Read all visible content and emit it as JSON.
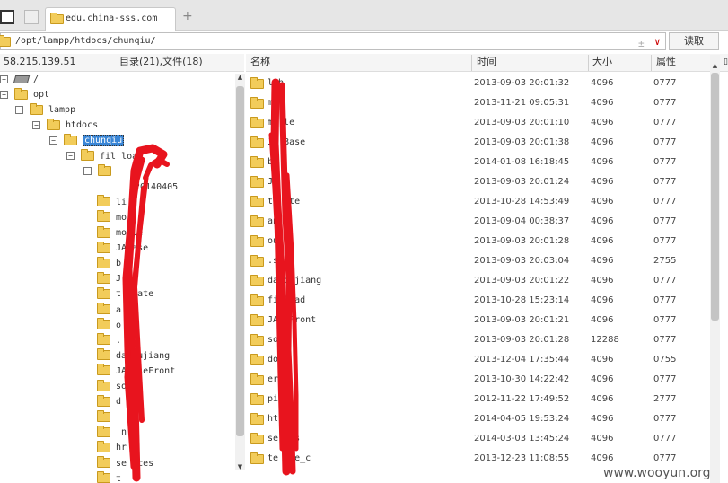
{
  "tabbar": {
    "tab_title": "edu.china-sss.com",
    "new_tab": "+"
  },
  "address": {
    "path": "/opt/lampp/htdocs/chunqiu/",
    "read_label": "读取"
  },
  "left_header": {
    "ip": "58.215.139.51",
    "summary": "目录(21),文件(18)"
  },
  "columns": {
    "name": "名称",
    "time": "时间",
    "size": "大小",
    "attr": "属性"
  },
  "tree": [
    {
      "label": "/",
      "toggle": "−",
      "icon": "drive"
    },
    {
      "label": "opt",
      "toggle": "−",
      "icon": "folder"
    },
    {
      "label": "lampp",
      "toggle": "−",
      "icon": "folder"
    },
    {
      "label": "htdocs",
      "toggle": "−",
      "icon": "folder"
    },
    {
      "label": "chunqiu",
      "toggle": "−",
      "icon": "folder",
      "selected": true
    },
    {
      "label": "fil   load",
      "toggle": "−",
      "icon": "folder"
    },
    {
      "label": "",
      "toggle": "−",
      "icon": "folder"
    },
    {
      "label": "20140405",
      "toggle": "",
      "icon": "none"
    },
    {
      "label": "li",
      "icon": "folder"
    },
    {
      "label": "mo",
      "icon": "folder"
    },
    {
      "label": "mo   le",
      "icon": "folder"
    },
    {
      "label": "JA   ase",
      "icon": "folder"
    },
    {
      "label": "b",
      "icon": "folder"
    },
    {
      "label": "J",
      "icon": "folder"
    },
    {
      "label": "t   plate",
      "icon": "folder"
    },
    {
      "label": "a   d",
      "icon": "folder"
    },
    {
      "label": "o",
      "icon": "folder"
    },
    {
      "label": ".",
      "icon": "folder"
    },
    {
      "label": "da   oujiang",
      "icon": "folder"
    },
    {
      "label": "JA   aseFront",
      "icon": "folder"
    },
    {
      "label": "so   ce",
      "icon": "folder"
    },
    {
      "label": "d",
      "icon": "folder"
    },
    {
      "label": "",
      "icon": "folder"
    },
    {
      "label": "   n",
      "icon": "folder"
    },
    {
      "label": "hr",
      "icon": "folder"
    },
    {
      "label": "se   ices",
      "icon": "folder"
    },
    {
      "label": "t",
      "icon": "folder"
    }
  ],
  "files": [
    {
      "name": "lib",
      "time": "2013-09-03 20:01:32",
      "size": "4096",
      "attr": "0777"
    },
    {
      "name": "mo",
      "time": "2013-11-21 09:05:31",
      "size": "4096",
      "attr": "0777"
    },
    {
      "name": "mo   le",
      "time": "2013-09-03 20:01:10",
      "size": "4096",
      "attr": "0777"
    },
    {
      "name": "JA   Base",
      "time": "2013-09-03 20:01:38",
      "size": "4096",
      "attr": "0777"
    },
    {
      "name": "bb",
      "time": "2014-01-08 16:18:45",
      "size": "4096",
      "attr": "0777"
    },
    {
      "name": "J",
      "time": "2013-09-03 20:01:24",
      "size": "4096",
      "attr": "0777"
    },
    {
      "name": "te   ate",
      "time": "2013-10-28 14:53:49",
      "size": "4096",
      "attr": "0777"
    },
    {
      "name": "an   d",
      "time": "2013-09-04 00:38:37",
      "size": "4096",
      "attr": "0777"
    },
    {
      "name": "ou",
      "time": "2013-09-03 20:01:28",
      "size": "4096",
      "attr": "0777"
    },
    {
      "name": ".s",
      "time": "2013-09-03 20:03:04",
      "size": "4096",
      "attr": "2755"
    },
    {
      "name": "da   oujiang",
      "time": "2013-09-03 20:01:22",
      "size": "4096",
      "attr": "0777"
    },
    {
      "name": "fi   load",
      "time": "2013-10-28 15:23:14",
      "size": "4096",
      "attr": "0777"
    },
    {
      "name": "JA   eFront",
      "time": "2013-09-03 20:01:21",
      "size": "4096",
      "attr": "0777"
    },
    {
      "name": "so",
      "time": "2013-09-03 20:01:28",
      "size": "12288",
      "attr": "0777"
    },
    {
      "name": "do",
      "time": "2013-12-04 17:35:44",
      "size": "4096",
      "attr": "0755"
    },
    {
      "name": "er",
      "time": "2013-10-30 14:22:42",
      "size": "4096",
      "attr": "0777"
    },
    {
      "name": "pi   a",
      "time": "2012-11-22 17:49:52",
      "size": "4096",
      "attr": "2777"
    },
    {
      "name": "ht",
      "time": "2014-04-05 19:53:24",
      "size": "4096",
      "attr": "0777"
    },
    {
      "name": "se   ces",
      "time": "2014-03-03 13:45:24",
      "size": "4096",
      "attr": "0777"
    },
    {
      "name": "te   ate_c",
      "time": "2013-12-23 11:08:55",
      "size": "4096",
      "attr": "0777"
    }
  ],
  "watermark": "www.wooyun.org",
  "annotation_color": "#e8141e"
}
